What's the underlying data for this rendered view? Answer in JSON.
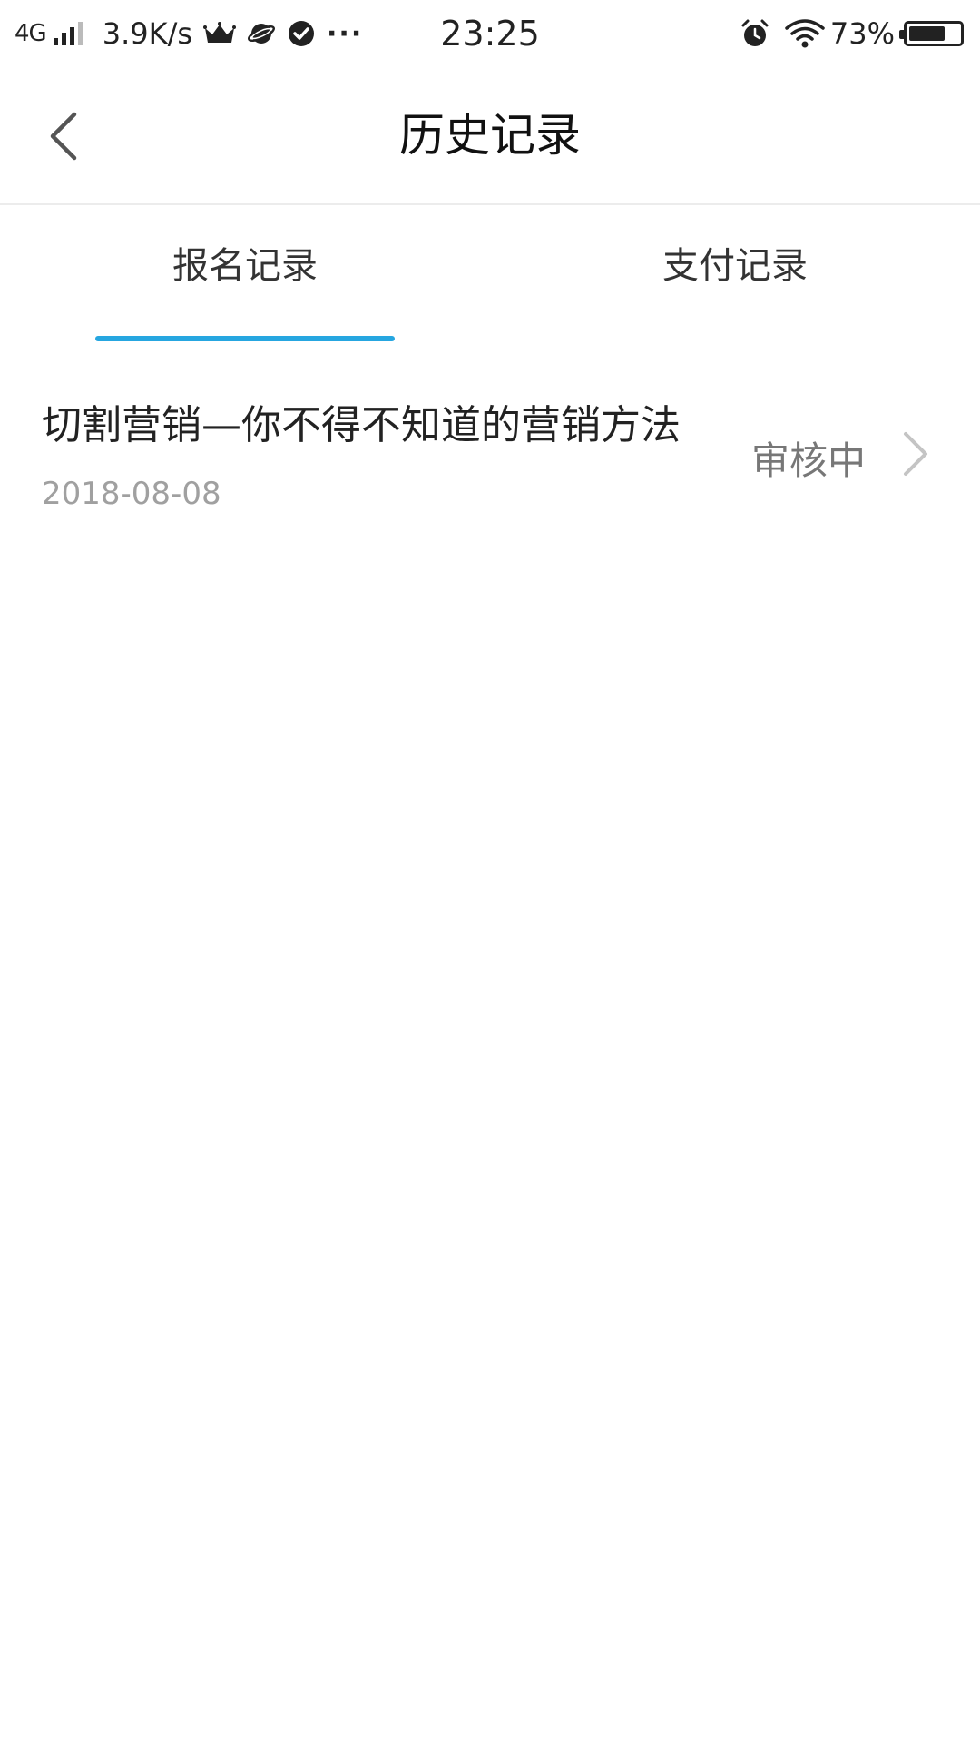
{
  "status_bar": {
    "network": "4G",
    "speed": "3.9K/s",
    "dots": "···",
    "time": "23:25",
    "battery_percent": "73%",
    "battery_level": 0.73,
    "icons": [
      "signal-icon",
      "crown-icon",
      "planet-icon",
      "check-circle-icon",
      "more-dots-icon",
      "alarm-icon",
      "wifi-icon",
      "battery-icon"
    ]
  },
  "header": {
    "title": "历史记录",
    "back_icon": "chevron-left-icon"
  },
  "tabs": [
    {
      "label": "报名记录",
      "active": true
    },
    {
      "label": "支付记录",
      "active": false
    }
  ],
  "colors": {
    "accent": "#26a6e0",
    "text_primary": "#222222",
    "text_secondary": "#a0a0a0",
    "status_text": "#777777"
  },
  "records": [
    {
      "title": "切割营销—你不得不知道的营销方法",
      "date": "2018-08-08",
      "status": "审核中",
      "arrow_icon": "chevron-right-icon"
    }
  ]
}
